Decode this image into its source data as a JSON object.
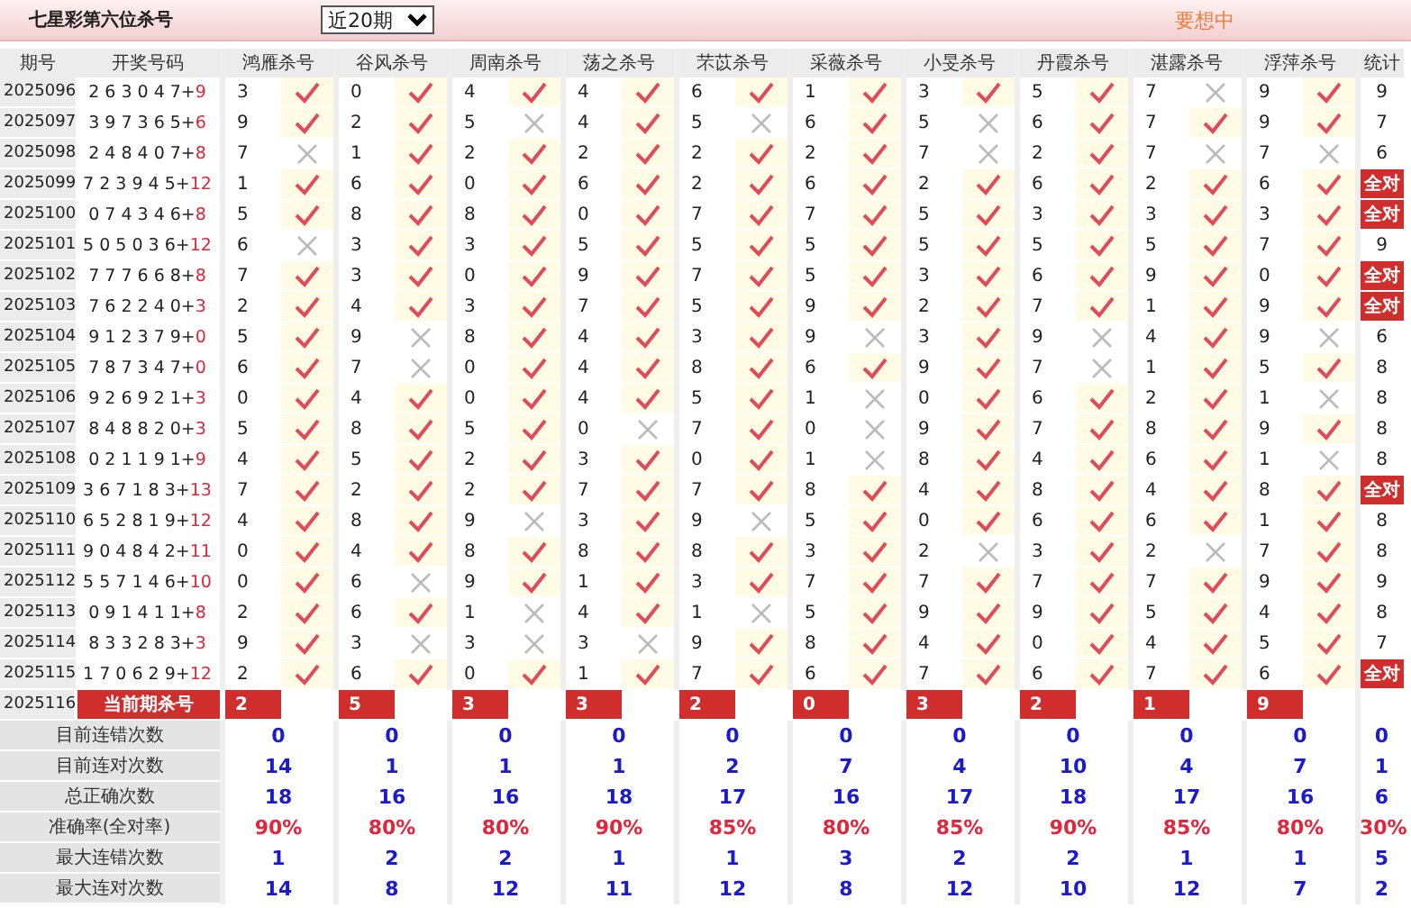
{
  "title": "七星彩第六位杀号",
  "period_select": {
    "value": "近20期"
  },
  "promo": "要想中",
  "columns": [
    "期号",
    "开奖号码",
    "鸿雁杀号",
    "谷风杀号",
    "周南杀号",
    "荡之杀号",
    "芣苡杀号",
    "采薇杀号",
    "小旻杀号",
    "丹霞杀号",
    "湛露杀号",
    "浮萍杀号",
    "统计"
  ],
  "rows": [
    {
      "period": "2025096",
      "numbers": "2 6 3 0 4 7+",
      "bonus": "9",
      "picks": [
        {
          "n": "3",
          "correct": true
        },
        {
          "n": "0",
          "correct": true
        },
        {
          "n": "4",
          "correct": true
        },
        {
          "n": "4",
          "correct": true
        },
        {
          "n": "6",
          "correct": true
        },
        {
          "n": "1",
          "correct": true
        },
        {
          "n": "3",
          "correct": true
        },
        {
          "n": "5",
          "correct": true
        },
        {
          "n": "7",
          "correct": false
        },
        {
          "n": "9",
          "correct": true
        }
      ],
      "stat": {
        "text": "9",
        "all_correct": false
      }
    },
    {
      "period": "2025097",
      "numbers": "3 9 7 3 6 5+",
      "bonus": "6",
      "picks": [
        {
          "n": "9",
          "correct": true
        },
        {
          "n": "2",
          "correct": true
        },
        {
          "n": "5",
          "correct": false
        },
        {
          "n": "4",
          "correct": true
        },
        {
          "n": "5",
          "correct": false
        },
        {
          "n": "6",
          "correct": true
        },
        {
          "n": "5",
          "correct": false
        },
        {
          "n": "6",
          "correct": true
        },
        {
          "n": "7",
          "correct": true
        },
        {
          "n": "9",
          "correct": true
        }
      ],
      "stat": {
        "text": "7",
        "all_correct": false
      }
    },
    {
      "period": "2025098",
      "numbers": "2 4 8 4 0 7+",
      "bonus": "8",
      "picks": [
        {
          "n": "7",
          "correct": false
        },
        {
          "n": "1",
          "correct": true
        },
        {
          "n": "2",
          "correct": true
        },
        {
          "n": "2",
          "correct": true
        },
        {
          "n": "2",
          "correct": true
        },
        {
          "n": "2",
          "correct": true
        },
        {
          "n": "7",
          "correct": false
        },
        {
          "n": "2",
          "correct": true
        },
        {
          "n": "7",
          "correct": false
        },
        {
          "n": "7",
          "correct": false
        }
      ],
      "stat": {
        "text": "6",
        "all_correct": false
      }
    },
    {
      "period": "2025099",
      "numbers": "7 2 3 9 4 5+",
      "bonus": "12",
      "picks": [
        {
          "n": "1",
          "correct": true
        },
        {
          "n": "6",
          "correct": true
        },
        {
          "n": "0",
          "correct": true
        },
        {
          "n": "6",
          "correct": true
        },
        {
          "n": "2",
          "correct": true
        },
        {
          "n": "6",
          "correct": true
        },
        {
          "n": "2",
          "correct": true
        },
        {
          "n": "6",
          "correct": true
        },
        {
          "n": "2",
          "correct": true
        },
        {
          "n": "6",
          "correct": true
        }
      ],
      "stat": {
        "text": "全对",
        "all_correct": true
      }
    },
    {
      "period": "2025100",
      "numbers": "0 7 4 3 4 6+",
      "bonus": "8",
      "picks": [
        {
          "n": "5",
          "correct": true
        },
        {
          "n": "8",
          "correct": true
        },
        {
          "n": "8",
          "correct": true
        },
        {
          "n": "0",
          "correct": true
        },
        {
          "n": "7",
          "correct": true
        },
        {
          "n": "7",
          "correct": true
        },
        {
          "n": "5",
          "correct": true
        },
        {
          "n": "3",
          "correct": true
        },
        {
          "n": "3",
          "correct": true
        },
        {
          "n": "3",
          "correct": true
        }
      ],
      "stat": {
        "text": "全对",
        "all_correct": true
      }
    },
    {
      "period": "2025101",
      "numbers": "5 0 5 0 3 6+",
      "bonus": "12",
      "picks": [
        {
          "n": "6",
          "correct": false
        },
        {
          "n": "3",
          "correct": true
        },
        {
          "n": "3",
          "correct": true
        },
        {
          "n": "5",
          "correct": true
        },
        {
          "n": "5",
          "correct": true
        },
        {
          "n": "5",
          "correct": true
        },
        {
          "n": "5",
          "correct": true
        },
        {
          "n": "5",
          "correct": true
        },
        {
          "n": "5",
          "correct": true
        },
        {
          "n": "7",
          "correct": true
        }
      ],
      "stat": {
        "text": "9",
        "all_correct": false
      }
    },
    {
      "period": "2025102",
      "numbers": "7 7 7 6 6 8+",
      "bonus": "8",
      "picks": [
        {
          "n": "7",
          "correct": true
        },
        {
          "n": "3",
          "correct": true
        },
        {
          "n": "0",
          "correct": true
        },
        {
          "n": "9",
          "correct": true
        },
        {
          "n": "7",
          "correct": true
        },
        {
          "n": "5",
          "correct": true
        },
        {
          "n": "3",
          "correct": true
        },
        {
          "n": "6",
          "correct": true
        },
        {
          "n": "9",
          "correct": true
        },
        {
          "n": "0",
          "correct": true
        }
      ],
      "stat": {
        "text": "全对",
        "all_correct": true
      }
    },
    {
      "period": "2025103",
      "numbers": "7 6 2 2 4 0+",
      "bonus": "3",
      "picks": [
        {
          "n": "2",
          "correct": true
        },
        {
          "n": "4",
          "correct": true
        },
        {
          "n": "3",
          "correct": true
        },
        {
          "n": "7",
          "correct": true
        },
        {
          "n": "5",
          "correct": true
        },
        {
          "n": "9",
          "correct": true
        },
        {
          "n": "2",
          "correct": true
        },
        {
          "n": "7",
          "correct": true
        },
        {
          "n": "1",
          "correct": true
        },
        {
          "n": "9",
          "correct": true
        }
      ],
      "stat": {
        "text": "全对",
        "all_correct": true
      }
    },
    {
      "period": "2025104",
      "numbers": "9 1 2 3 7 9+",
      "bonus": "0",
      "picks": [
        {
          "n": "5",
          "correct": true
        },
        {
          "n": "9",
          "correct": false
        },
        {
          "n": "8",
          "correct": true
        },
        {
          "n": "4",
          "correct": true
        },
        {
          "n": "3",
          "correct": true
        },
        {
          "n": "9",
          "correct": false
        },
        {
          "n": "3",
          "correct": true
        },
        {
          "n": "9",
          "correct": false
        },
        {
          "n": "4",
          "correct": true
        },
        {
          "n": "9",
          "correct": false
        }
      ],
      "stat": {
        "text": "6",
        "all_correct": false
      }
    },
    {
      "period": "2025105",
      "numbers": "7 8 7 3 4 7+",
      "bonus": "0",
      "picks": [
        {
          "n": "6",
          "correct": true
        },
        {
          "n": "7",
          "correct": false
        },
        {
          "n": "0",
          "correct": true
        },
        {
          "n": "4",
          "correct": true
        },
        {
          "n": "8",
          "correct": true
        },
        {
          "n": "6",
          "correct": true
        },
        {
          "n": "9",
          "correct": true
        },
        {
          "n": "7",
          "correct": false
        },
        {
          "n": "1",
          "correct": true
        },
        {
          "n": "5",
          "correct": true
        }
      ],
      "stat": {
        "text": "8",
        "all_correct": false
      }
    },
    {
      "period": "2025106",
      "numbers": "9 2 6 9 2 1+",
      "bonus": "3",
      "picks": [
        {
          "n": "0",
          "correct": true
        },
        {
          "n": "4",
          "correct": true
        },
        {
          "n": "0",
          "correct": true
        },
        {
          "n": "4",
          "correct": true
        },
        {
          "n": "5",
          "correct": true
        },
        {
          "n": "1",
          "correct": false
        },
        {
          "n": "0",
          "correct": true
        },
        {
          "n": "6",
          "correct": true
        },
        {
          "n": "2",
          "correct": true
        },
        {
          "n": "1",
          "correct": false
        }
      ],
      "stat": {
        "text": "8",
        "all_correct": false
      }
    },
    {
      "period": "2025107",
      "numbers": "8 4 8 8 2 0+",
      "bonus": "3",
      "picks": [
        {
          "n": "5",
          "correct": true
        },
        {
          "n": "8",
          "correct": true
        },
        {
          "n": "5",
          "correct": true
        },
        {
          "n": "0",
          "correct": false
        },
        {
          "n": "7",
          "correct": true
        },
        {
          "n": "0",
          "correct": false
        },
        {
          "n": "9",
          "correct": true
        },
        {
          "n": "7",
          "correct": true
        },
        {
          "n": "8",
          "correct": true
        },
        {
          "n": "9",
          "correct": true
        }
      ],
      "stat": {
        "text": "8",
        "all_correct": false
      }
    },
    {
      "period": "2025108",
      "numbers": "0 2 1 1 9 1+",
      "bonus": "9",
      "picks": [
        {
          "n": "4",
          "correct": true
        },
        {
          "n": "5",
          "correct": true
        },
        {
          "n": "2",
          "correct": true
        },
        {
          "n": "3",
          "correct": true
        },
        {
          "n": "0",
          "correct": true
        },
        {
          "n": "1",
          "correct": false
        },
        {
          "n": "8",
          "correct": true
        },
        {
          "n": "4",
          "correct": true
        },
        {
          "n": "6",
          "correct": true
        },
        {
          "n": "1",
          "correct": false
        }
      ],
      "stat": {
        "text": "8",
        "all_correct": false
      }
    },
    {
      "period": "2025109",
      "numbers": "3 6 7 1 8 3+",
      "bonus": "13",
      "picks": [
        {
          "n": "7",
          "correct": true
        },
        {
          "n": "2",
          "correct": true
        },
        {
          "n": "2",
          "correct": true
        },
        {
          "n": "7",
          "correct": true
        },
        {
          "n": "7",
          "correct": true
        },
        {
          "n": "8",
          "correct": true
        },
        {
          "n": "4",
          "correct": true
        },
        {
          "n": "8",
          "correct": true
        },
        {
          "n": "4",
          "correct": true
        },
        {
          "n": "8",
          "correct": true
        }
      ],
      "stat": {
        "text": "全对",
        "all_correct": true
      }
    },
    {
      "period": "2025110",
      "numbers": "6 5 2 8 1 9+",
      "bonus": "12",
      "picks": [
        {
          "n": "4",
          "correct": true
        },
        {
          "n": "8",
          "correct": true
        },
        {
          "n": "9",
          "correct": false
        },
        {
          "n": "3",
          "correct": true
        },
        {
          "n": "9",
          "correct": false
        },
        {
          "n": "5",
          "correct": true
        },
        {
          "n": "0",
          "correct": true
        },
        {
          "n": "6",
          "correct": true
        },
        {
          "n": "6",
          "correct": true
        },
        {
          "n": "1",
          "correct": true
        }
      ],
      "stat": {
        "text": "8",
        "all_correct": false
      }
    },
    {
      "period": "2025111",
      "numbers": "9 0 4 8 4 2+",
      "bonus": "11",
      "picks": [
        {
          "n": "0",
          "correct": true
        },
        {
          "n": "4",
          "correct": true
        },
        {
          "n": "8",
          "correct": true
        },
        {
          "n": "8",
          "correct": true
        },
        {
          "n": "8",
          "correct": true
        },
        {
          "n": "3",
          "correct": true
        },
        {
          "n": "2",
          "correct": false
        },
        {
          "n": "3",
          "correct": true
        },
        {
          "n": "2",
          "correct": false
        },
        {
          "n": "7",
          "correct": true
        }
      ],
      "stat": {
        "text": "8",
        "all_correct": false
      }
    },
    {
      "period": "2025112",
      "numbers": "5 5 7 1 4 6+",
      "bonus": "10",
      "picks": [
        {
          "n": "0",
          "correct": true
        },
        {
          "n": "6",
          "correct": false
        },
        {
          "n": "9",
          "correct": true
        },
        {
          "n": "1",
          "correct": true
        },
        {
          "n": "3",
          "correct": true
        },
        {
          "n": "7",
          "correct": true
        },
        {
          "n": "7",
          "correct": true
        },
        {
          "n": "7",
          "correct": true
        },
        {
          "n": "7",
          "correct": true
        },
        {
          "n": "9",
          "correct": true
        }
      ],
      "stat": {
        "text": "9",
        "all_correct": false
      }
    },
    {
      "period": "2025113",
      "numbers": "0 9 1 4 1 1+",
      "bonus": "8",
      "picks": [
        {
          "n": "2",
          "correct": true
        },
        {
          "n": "6",
          "correct": true
        },
        {
          "n": "1",
          "correct": false
        },
        {
          "n": "4",
          "correct": true
        },
        {
          "n": "1",
          "correct": false
        },
        {
          "n": "5",
          "correct": true
        },
        {
          "n": "9",
          "correct": true
        },
        {
          "n": "9",
          "correct": true
        },
        {
          "n": "5",
          "correct": true
        },
        {
          "n": "4",
          "correct": true
        }
      ],
      "stat": {
        "text": "8",
        "all_correct": false
      }
    },
    {
      "period": "2025114",
      "numbers": "8 3 3 2 8 3+",
      "bonus": "3",
      "picks": [
        {
          "n": "9",
          "correct": true
        },
        {
          "n": "3",
          "correct": false
        },
        {
          "n": "3",
          "correct": false
        },
        {
          "n": "3",
          "correct": false
        },
        {
          "n": "9",
          "correct": true
        },
        {
          "n": "8",
          "correct": true
        },
        {
          "n": "4",
          "correct": true
        },
        {
          "n": "0",
          "correct": true
        },
        {
          "n": "4",
          "correct": true
        },
        {
          "n": "5",
          "correct": true
        }
      ],
      "stat": {
        "text": "7",
        "all_correct": false
      }
    },
    {
      "period": "2025115",
      "numbers": "1 7 0 6 2 9+",
      "bonus": "12",
      "picks": [
        {
          "n": "2",
          "correct": true
        },
        {
          "n": "6",
          "correct": true
        },
        {
          "n": "0",
          "correct": true
        },
        {
          "n": "1",
          "correct": true
        },
        {
          "n": "7",
          "correct": true
        },
        {
          "n": "6",
          "correct": true
        },
        {
          "n": "7",
          "correct": true
        },
        {
          "n": "6",
          "correct": true
        },
        {
          "n": "7",
          "correct": true
        },
        {
          "n": "6",
          "correct": true
        }
      ],
      "stat": {
        "text": "全对",
        "all_correct": true
      }
    }
  ],
  "current": {
    "period": "2025116",
    "label": "当前期杀号",
    "kills": [
      "2",
      "5",
      "3",
      "3",
      "2",
      "0",
      "3",
      "2",
      "1",
      "9"
    ]
  },
  "stats": [
    {
      "label": "目前连错次数",
      "kind": "count",
      "values": [
        "0",
        "0",
        "0",
        "0",
        "0",
        "0",
        "0",
        "0",
        "0",
        "0",
        "0"
      ]
    },
    {
      "label": "目前连对次数",
      "kind": "count",
      "values": [
        "14",
        "1",
        "1",
        "1",
        "2",
        "7",
        "4",
        "10",
        "4",
        "7",
        "1"
      ]
    },
    {
      "label": "总正确次数",
      "kind": "count",
      "values": [
        "18",
        "16",
        "16",
        "18",
        "17",
        "16",
        "17",
        "18",
        "17",
        "16",
        "6"
      ]
    },
    {
      "label": "准确率(全对率)",
      "kind": "rate",
      "values": [
        "90%",
        "80%",
        "80%",
        "90%",
        "85%",
        "80%",
        "85%",
        "90%",
        "85%",
        "80%",
        "30%"
      ]
    },
    {
      "label": "最大连错次数",
      "kind": "count",
      "values": [
        "1",
        "2",
        "2",
        "1",
        "1",
        "3",
        "2",
        "2",
        "1",
        "1",
        "5"
      ]
    },
    {
      "label": "最大连对次数",
      "kind": "count",
      "values": [
        "14",
        "8",
        "12",
        "11",
        "12",
        "8",
        "12",
        "10",
        "12",
        "7",
        "2"
      ]
    }
  ]
}
